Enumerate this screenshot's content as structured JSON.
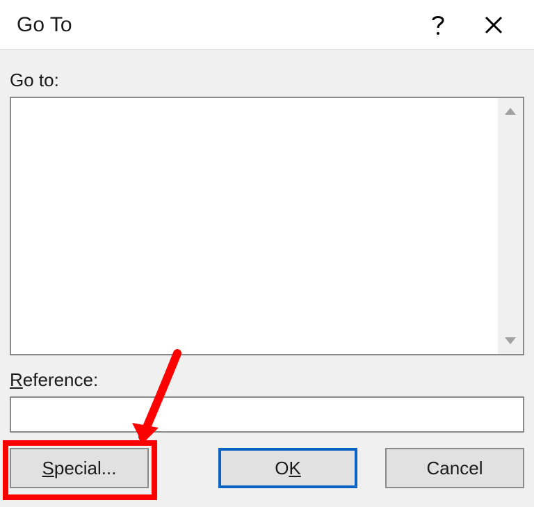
{
  "titlebar": {
    "title": "Go To"
  },
  "labels": {
    "goto": "Go to:",
    "reference_prefix_ul": "R",
    "reference_rest": "eference:"
  },
  "reference_value": "",
  "buttons": {
    "special_ul": "S",
    "special_rest": "pecial...",
    "ok_prefix": "O",
    "ok_ul": "K",
    "cancel": "Cancel"
  }
}
